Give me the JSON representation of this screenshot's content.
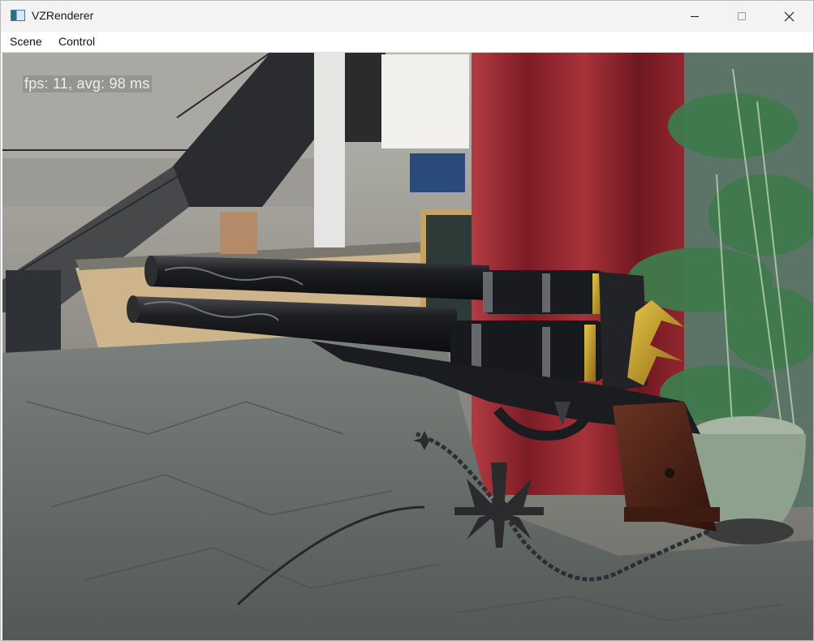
{
  "window": {
    "title": "VZRenderer",
    "controls": {
      "minimize": "minimize",
      "maximize": "maximize",
      "close": "✕"
    }
  },
  "menu": {
    "items": [
      {
        "label": "Scene"
      },
      {
        "label": "Control"
      }
    ]
  },
  "viewport": {
    "fps_text": "fps: 11, avg: 98 ms",
    "scene": "3D render of ornate revolver model over indoor lobby environment map",
    "colors": {
      "floor": "#5f6664",
      "curtain": "#9c2a32",
      "gun_metal": "#1e1f22",
      "gold": "#c8a22a",
      "grip": "#4a2418",
      "plant": "#3f7a4c"
    }
  }
}
